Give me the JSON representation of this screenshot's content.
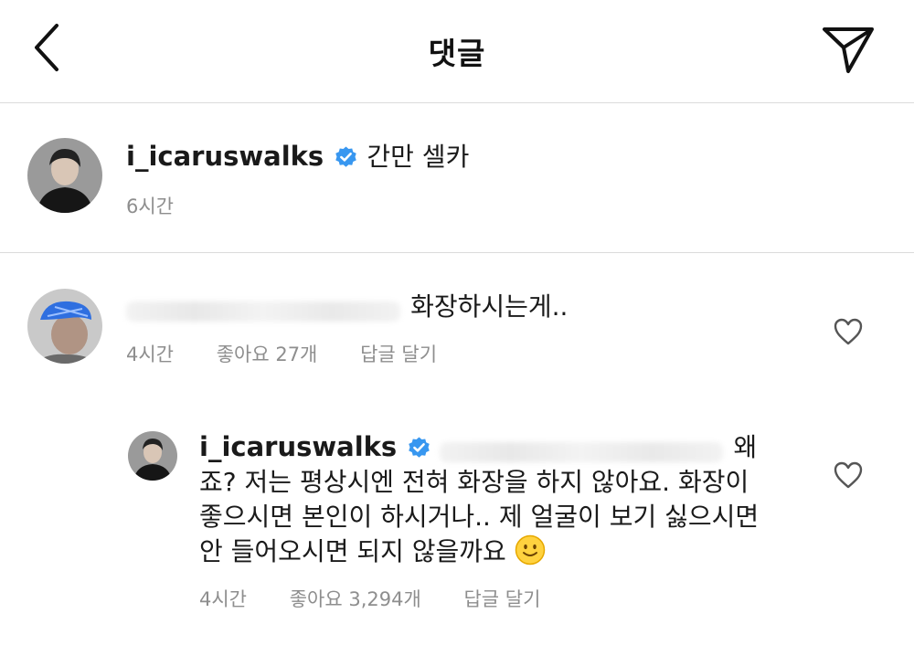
{
  "header": {
    "title": "댓글",
    "back_icon": "chevron-left-icon",
    "share_icon": "paper-plane-icon"
  },
  "caption": {
    "username": "i_icaruswalks",
    "text": "간만 셀카",
    "time": "6시간"
  },
  "comments": [
    {
      "username_hidden": true,
      "text": "화장하시는게..",
      "time": "4시간",
      "likes": "좋아요 27개",
      "reply": "답글 달기"
    },
    {
      "username": "i_icaruswalks",
      "line1": "왜",
      "line2": "죠? 저는 평상시엔 전혀 화장을 하지 않아요. 화장이",
      "line3": "좋으시면 본인이 하시거나.. 제 얼굴이 보기 싫으시면",
      "line4": "안 들어오시면 되지 않을까요",
      "emoji": "slightly-smiling-face",
      "time": "4시간",
      "likes": "좋아요 3,294개",
      "reply": "답글 달기"
    }
  ],
  "colors": {
    "verified": "#3897f0",
    "meta": "#8e8e8e",
    "divider": "#dbdbdb"
  }
}
